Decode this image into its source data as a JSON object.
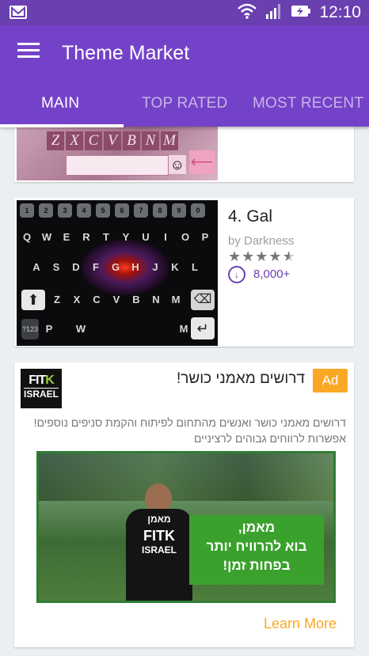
{
  "status_bar": {
    "time": "12:10"
  },
  "app_bar": {
    "title": "Theme Market"
  },
  "tabs": [
    {
      "label": "MAIN"
    },
    {
      "label": "TOP RATED"
    },
    {
      "label": "MOST RECENT"
    }
  ],
  "preview_keyboard_top": {
    "keys": [
      "Z",
      "X",
      "C",
      "V",
      "B",
      "N",
      "M"
    ]
  },
  "theme": {
    "title": "4. Gal",
    "author": "by Darkness",
    "rating": 4.5,
    "rating_max": 5,
    "downloads": "8,000+"
  },
  "keyboard_preview": {
    "row_numbers": [
      "1",
      "2",
      "3",
      "4",
      "5",
      "6",
      "7",
      "8",
      "9",
      "0"
    ],
    "row1": [
      "Q",
      "W",
      "E",
      "R",
      "T",
      "Y",
      "U",
      "I",
      "O",
      "P"
    ],
    "row2": [
      "A",
      "S",
      "D",
      "F",
      "G",
      "H",
      "J",
      "K",
      "L"
    ],
    "row3": [
      "Z",
      "X",
      "C",
      "V",
      "B",
      "N",
      "M"
    ],
    "row4": [
      "P",
      "W",
      "M"
    ],
    "key_123": "?123"
  },
  "ad": {
    "badge": "Ad",
    "logo_line1_a": "FIT",
    "logo_line1_b": "K",
    "logo_line2": "ISRAEL",
    "headline": "דרושים מאמני כושר!",
    "body": "דרושים מאמני כושר ואנשים מהתחום לפיתוח והקמת סניפים נוספים! אפשרות לרווחים גבוהים לרציניים",
    "image_shirt_top": "מאמן",
    "image_shirt_brand": "FITK",
    "image_shirt_country": "ISRAEL",
    "image_line1": "מאמן,",
    "image_line2": "בוא להרוויח יותר",
    "image_line3": "בפחות זמן!",
    "cta": "Learn More"
  },
  "colors": {
    "primary": "#7442C8",
    "status_bar": "#6A3FB0",
    "accent": "#F9A825",
    "background": "#ECEFF1"
  }
}
